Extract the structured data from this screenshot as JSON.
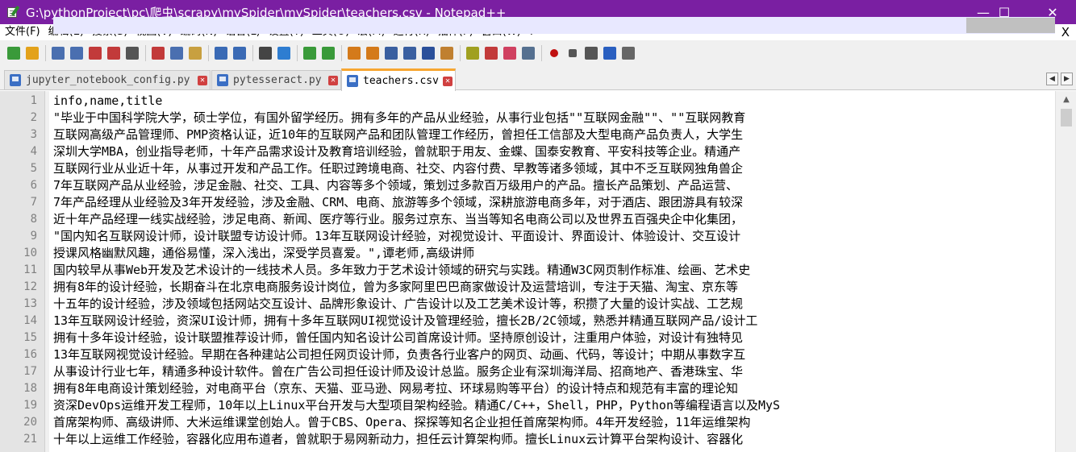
{
  "window": {
    "title": "G:\\pythonProject\\pc\\爬虫\\scrapy\\mySpider\\mySpider\\teachers.csv - Notepad++",
    "minimize": "—",
    "maximize": "☐",
    "close": "✕"
  },
  "menu": {
    "items": [
      "文件(F)",
      "编辑(E)",
      "搜索(S)",
      "视图(V)",
      "编码(N)",
      "语言(L)",
      "设置(T)",
      "工具(O)",
      "宏(M)",
      "运行(R)",
      "插件(P)",
      "窗口(W)",
      "?"
    ],
    "close": "X"
  },
  "toolbar": {
    "icons": [
      "new-file-icon",
      "open-file-icon",
      "save-icon",
      "save-all-icon",
      "close-icon",
      "close-all-icon",
      "print-icon",
      "cut-icon",
      "copy-icon",
      "paste-icon",
      "undo-icon",
      "redo-icon",
      "find-icon",
      "replace-icon",
      "zoom-in-icon",
      "zoom-out-icon",
      "sync-vertical-icon",
      "sync-horizontal-icon",
      "word-wrap-icon",
      "show-all-chars-icon",
      "indent-guide-icon",
      "user-lang-icon",
      "doc-map-icon",
      "function-list-icon",
      "folder-workspace-icon",
      "monitor-icon",
      "record-macro-icon",
      "stop-macro-icon",
      "play-macro-icon",
      "run-macro-multiple-icon",
      "save-macro-icon"
    ],
    "colors": {
      "accent": "#f7a631",
      "title_bar": "#7a1fa2"
    }
  },
  "tabs": [
    {
      "label": "jupyter_notebook_config.py",
      "active": false,
      "icon": "blue"
    },
    {
      "label": "pytesseract.py",
      "active": false,
      "icon": "blue"
    },
    {
      "label": "teachers.csv",
      "active": true,
      "icon": "blue"
    }
  ],
  "editor": {
    "current_line": 2,
    "lines": [
      "info,name,title",
      "\"毕业于中国科学院大学，硕士学位，有国外留学经历。拥有多年的产品从业经验，从事行业包括\"\"互联网金融\"\"、\"\"互联网教育",
      "互联网高级产品管理师、PMP资格认证，近10年的互联网产品和团队管理工作经历，曾担任工信部及大型电商产品负责人，大学生",
      "深圳大学MBA，创业指导老师，十年产品需求设计及教育培训经验，曾就职于用友、金蝶、国泰安教育、平安科技等企业。精通产",
      "互联网行业从业近十年，从事过开发和产品工作。任职过跨境电商、社交、内容付费、早教等诸多领域，其中不乏互联网独角兽企",
      "7年互联网产品从业经验，涉足金融、社交、工具、内容等多个领域，策划过多款百万级用户的产品。擅长产品策划、产品运营、",
      "7年产品经理从业经验及3年开发经验，涉及金融、CRM、电商、旅游等多个领域，深耕旅游电商多年，对于酒店、跟团游具有较深",
      "近十年产品经理一线实战经验，涉足电商、新闻、医疗等行业。服务过京东、当当等知名电商公司以及世界五百强央企中化集团，",
      "\"国内知名互联网设计师，设计联盟专访设计师。13年互联网设计经验，对视觉设计、平面设计、界面设计、体验设计、交互设计",
      "授课风格幽默风趣，通俗易懂，深入浅出，深受学员喜爱。\",谭老师,高级讲师",
      "国内较早从事Web开发及艺术设计的一线技术人员。多年致力于艺术设计领域的研究与实践。精通W3C网页制作标准、绘画、艺术史",
      "拥有8年的设计经验，长期奋斗在北京电商服务设计岗位，曾为多家阿里巴巴商家做设计及运营培训，专注于天猫、淘宝、京东等",
      "十五年的设计经验，涉及领域包括网站交互设计、品牌形象设计、广告设计以及工艺美术设计等，积攒了大量的设计实战、工艺规",
      "13年互联网设计经验，资深UI设计师，拥有十多年互联网UI视觉设计及管理经验，擅长2B/2C领域，熟悉并精通互联网产品/设计工",
      "拥有十多年设计经验，设计联盟推荐设计师，曾任国内知名设计公司首席设计师。坚持原创设计，注重用户体验，对设计有独特见",
      "13年互联网视觉设计经验。早期在各种建站公司担任网页设计师，负责各行业客户的网页、动画、代码，等设计；中期从事数字互",
      "从事设计行业七年，精通多种设计软件。曾在广告公司担任设计师及设计总监。服务企业有深圳海洋局、招商地产、香港珠宝、华",
      "拥有8年电商设计策划经验，对电商平台（京东、天猫、亚马逊、网易考拉、环球易购等平台）的设计特点和规范有丰富的理论知",
      "资深DevOps运维开发工程师，10年以上Linux平台开发与大型项目架构经验。精通C/C++，Shell，PHP，Python等编程语言以及MyS",
      "首席架构师、高级讲师、大米运维课堂创始人。曾于CBS、Opera、探探等知名企业担任首席架构师。4年开发经验，11年运维架构",
      "十年以上运维工作经验，容器化应用布道者，曾就职于易网新动力，担任云计算架构师。擅长Linux云计算平台架构设计、容器化"
    ]
  }
}
